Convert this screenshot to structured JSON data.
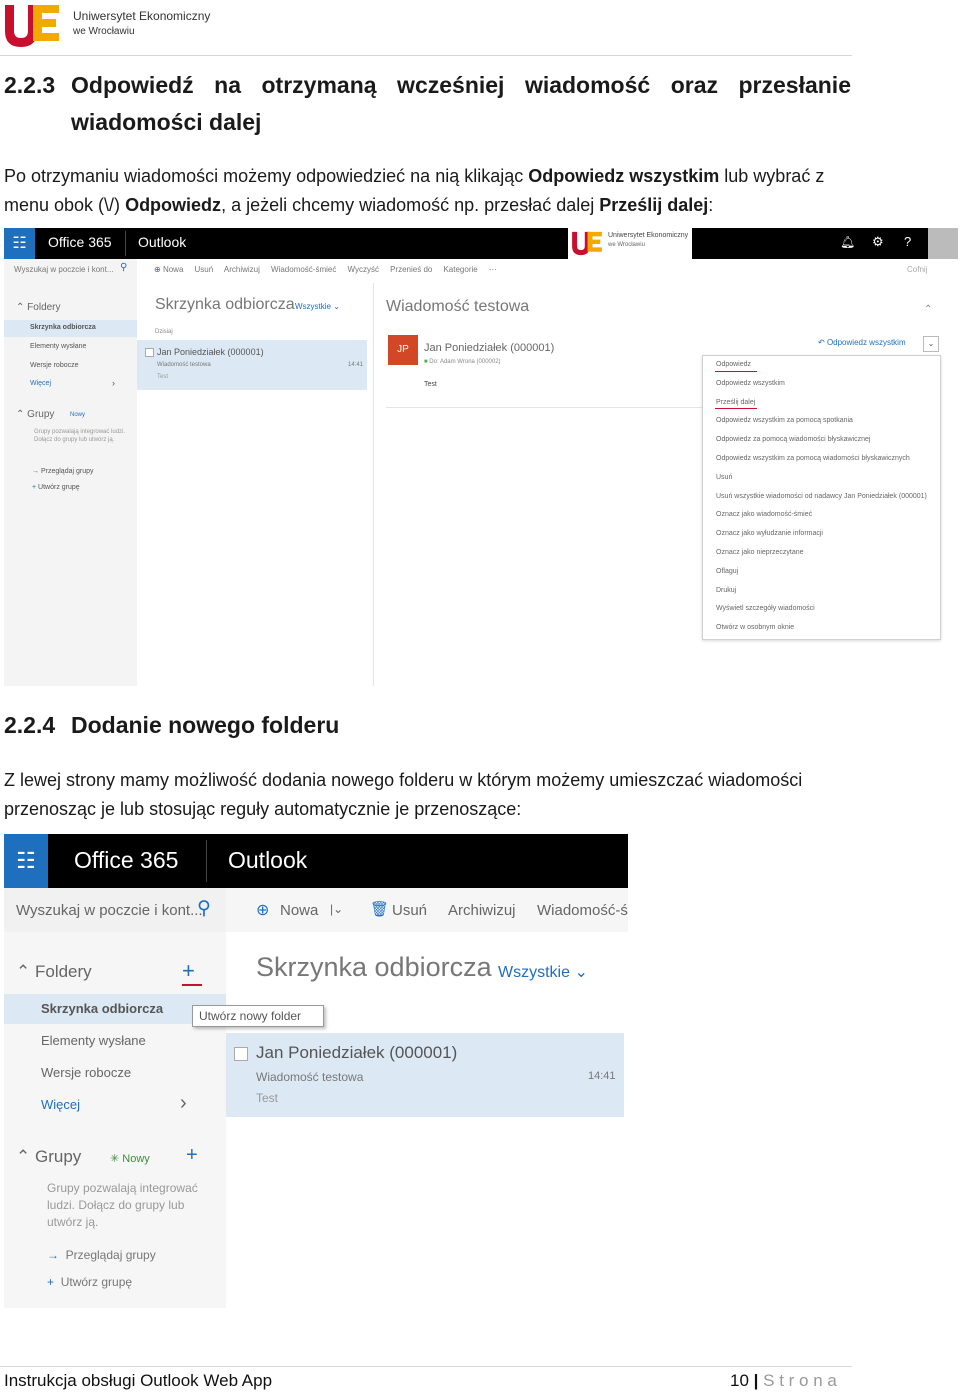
{
  "header": {
    "university_line1": "Uniwersytet Ekonomiczny",
    "university_line2": "we Wrocławiu"
  },
  "section_223": {
    "number": "2.2.3",
    "title_line1": "Odpowiedź na otrzymaną wcześniej wiadomość oraz przesłanie",
    "title_line2": "wiadomości dalej",
    "para_l1_a": "Po otrzymaniu wiadomości możemy odpowiedzieć na nią klikając ",
    "para_l1_b": "Odpowiedz wszystkim",
    "para_l1_c": " lub wybrać z",
    "para_l2_a": "menu obok (\\/) ",
    "para_l2_b": "Odpowiedz",
    "para_l2_c": ", a jeżeli chcemy wiadomość np. przesłać dalej ",
    "para_l2_d": "Prześlij dalej",
    "para_l2_e": ":"
  },
  "screenshot1": {
    "office": "Office 365",
    "app": "Outlook",
    "logo_text": "Uniwersytet Ekonomiczny",
    "logo_sub": "we Wrocławiu",
    "search": "Wyszukaj w poczcie i kont...",
    "cmds": [
      "Nowa",
      "Usuń",
      "Archiwizuj",
      "Wiadomość-śmieć",
      "Wyczyść",
      "Przenieś do",
      "Kategorie",
      "···"
    ],
    "undo": "Cofnij",
    "folders_label": "Foldery",
    "folders": [
      "Skrzynka odbiorcza",
      "Elementy wysłane",
      "Wersje robocze",
      "Więcej"
    ],
    "groups_label": "Grupy",
    "groups_new": "Nowy",
    "groups_desc": "Grupy pozwalają integrować ludzi. Dołącz do grupy lub utwórz ją.",
    "groups_browse": "Przeglądaj grupy",
    "groups_create": "Utwórz grupę",
    "inbox": "Skrzynka odbiorcza",
    "filter": "Wszystkie",
    "today": "Dzisiaj",
    "msg_sender": "Jan Poniedziałek (000001)",
    "msg_subject": "Wiadomość testowa",
    "msg_preview": "Test",
    "msg_time": "14:41",
    "read_title": "Wiadomość testowa",
    "avatar": "JP",
    "read_sender": "Jan Poniedziałek (000001)",
    "read_to": "Do: Adam Wrona (000002)",
    "read_body": "Test",
    "reply_all": "Odpowiedz wszystkim",
    "menu": [
      "Odpowiedz",
      "Odpowiedz wszystkim",
      "Prześlij dalej",
      "Odpowiedz wszystkim za pomocą spotkania",
      "Odpowiedz za pomocą wiadomości błyskawicznej",
      "Odpowiedz wszystkim za pomocą wiadomości błyskawicznych",
      "Usuń",
      "Usuń wszystkie wiadomości od nadawcy Jan Poniedziałek (000001)",
      "Oznacz jako wiadomość-śmieć",
      "Oznacz jako wyłudzanie informacji",
      "Oznacz jako nieprzeczytane",
      "Oflaguj",
      "Drukuj",
      "Wyświetl szczegóły wiadomości",
      "Otwórz w osobnym oknie"
    ]
  },
  "section_224": {
    "number": "2.2.4",
    "title": "Dodanie nowego folderu",
    "para_l1": "Z lewej strony mamy możliwość dodania nowego folderu w którym możemy umieszczać wiadomości",
    "para_l2": "przenosząc je lub stosując reguły automatycznie je przenoszące:"
  },
  "screenshot2": {
    "office": "Office 365",
    "app": "Outlook",
    "search": "Wyszukaj w poczcie i kont...",
    "cmd_new": "Nowa",
    "cmd_delete": "Usuń",
    "cmd_archive": "Archiwizuj",
    "cmd_junk": "Wiadomość-ś",
    "folders_label": "Foldery",
    "tooltip": "Utwórz nowy folder",
    "folders": [
      "Skrzynka odbiorcza",
      "Elementy wysłane",
      "Wersje robocze",
      "Więcej"
    ],
    "groups_label": "Grupy",
    "groups_new": "Nowy",
    "groups_desc_l1": "Grupy pozwalają integrować",
    "groups_desc_l2": "ludzi. Dołącz do grupy lub",
    "groups_desc_l3": "utwórz ją.",
    "groups_browse": "Przeglądaj grupy",
    "groups_create": "Utwórz grupę",
    "inbox": "Skrzynka odbiorcza",
    "filter": "Wszystkie",
    "msg_sender": "Jan Poniedziałek (000001)",
    "msg_subject": "Wiadomość testowa",
    "msg_preview": "Test",
    "msg_time": "14:41"
  },
  "footer": {
    "left": "Instrukcja obsługi Outlook Web App",
    "page": "10",
    "sep": "|",
    "word": "S t r o n a"
  },
  "colors": {
    "brand_red": "#c8102e",
    "brand_orange": "#f2a900",
    "office_blue": "#1f6fbf",
    "topbar": "#000000",
    "selected": "#dce9f5"
  }
}
